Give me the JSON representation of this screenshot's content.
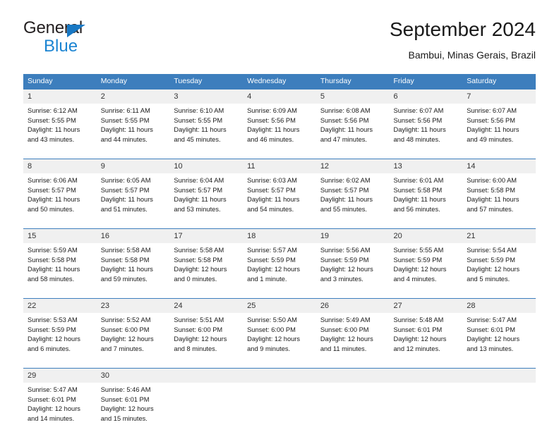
{
  "brand": {
    "word1": "General",
    "word2": "Blue",
    "triangle_color": "#1878c4",
    "blue_color": "#1b84d2"
  },
  "header": {
    "month_title": "September 2024",
    "location": "Bambui, Minas Gerais, Brazil"
  },
  "theme": {
    "header_blue": "#3d7ebd",
    "daynum_gray": "#f0f0f0",
    "text": "#1a1a1a"
  },
  "weekday_headers": [
    "Sunday",
    "Monday",
    "Tuesday",
    "Wednesday",
    "Thursday",
    "Friday",
    "Saturday"
  ],
  "weeks": [
    [
      {
        "day": "1",
        "sunrise": "Sunrise: 6:12 AM",
        "sunset": "Sunset: 5:55 PM",
        "daylight1": "Daylight: 11 hours",
        "daylight2": "and 43 minutes."
      },
      {
        "day": "2",
        "sunrise": "Sunrise: 6:11 AM",
        "sunset": "Sunset: 5:55 PM",
        "daylight1": "Daylight: 11 hours",
        "daylight2": "and 44 minutes."
      },
      {
        "day": "3",
        "sunrise": "Sunrise: 6:10 AM",
        "sunset": "Sunset: 5:55 PM",
        "daylight1": "Daylight: 11 hours",
        "daylight2": "and 45 minutes."
      },
      {
        "day": "4",
        "sunrise": "Sunrise: 6:09 AM",
        "sunset": "Sunset: 5:56 PM",
        "daylight1": "Daylight: 11 hours",
        "daylight2": "and 46 minutes."
      },
      {
        "day": "5",
        "sunrise": "Sunrise: 6:08 AM",
        "sunset": "Sunset: 5:56 PM",
        "daylight1": "Daylight: 11 hours",
        "daylight2": "and 47 minutes."
      },
      {
        "day": "6",
        "sunrise": "Sunrise: 6:07 AM",
        "sunset": "Sunset: 5:56 PM",
        "daylight1": "Daylight: 11 hours",
        "daylight2": "and 48 minutes."
      },
      {
        "day": "7",
        "sunrise": "Sunrise: 6:07 AM",
        "sunset": "Sunset: 5:56 PM",
        "daylight1": "Daylight: 11 hours",
        "daylight2": "and 49 minutes."
      }
    ],
    [
      {
        "day": "8",
        "sunrise": "Sunrise: 6:06 AM",
        "sunset": "Sunset: 5:57 PM",
        "daylight1": "Daylight: 11 hours",
        "daylight2": "and 50 minutes."
      },
      {
        "day": "9",
        "sunrise": "Sunrise: 6:05 AM",
        "sunset": "Sunset: 5:57 PM",
        "daylight1": "Daylight: 11 hours",
        "daylight2": "and 51 minutes."
      },
      {
        "day": "10",
        "sunrise": "Sunrise: 6:04 AM",
        "sunset": "Sunset: 5:57 PM",
        "daylight1": "Daylight: 11 hours",
        "daylight2": "and 53 minutes."
      },
      {
        "day": "11",
        "sunrise": "Sunrise: 6:03 AM",
        "sunset": "Sunset: 5:57 PM",
        "daylight1": "Daylight: 11 hours",
        "daylight2": "and 54 minutes."
      },
      {
        "day": "12",
        "sunrise": "Sunrise: 6:02 AM",
        "sunset": "Sunset: 5:57 PM",
        "daylight1": "Daylight: 11 hours",
        "daylight2": "and 55 minutes."
      },
      {
        "day": "13",
        "sunrise": "Sunrise: 6:01 AM",
        "sunset": "Sunset: 5:58 PM",
        "daylight1": "Daylight: 11 hours",
        "daylight2": "and 56 minutes."
      },
      {
        "day": "14",
        "sunrise": "Sunrise: 6:00 AM",
        "sunset": "Sunset: 5:58 PM",
        "daylight1": "Daylight: 11 hours",
        "daylight2": "and 57 minutes."
      }
    ],
    [
      {
        "day": "15",
        "sunrise": "Sunrise: 5:59 AM",
        "sunset": "Sunset: 5:58 PM",
        "daylight1": "Daylight: 11 hours",
        "daylight2": "and 58 minutes."
      },
      {
        "day": "16",
        "sunrise": "Sunrise: 5:58 AM",
        "sunset": "Sunset: 5:58 PM",
        "daylight1": "Daylight: 11 hours",
        "daylight2": "and 59 minutes."
      },
      {
        "day": "17",
        "sunrise": "Sunrise: 5:58 AM",
        "sunset": "Sunset: 5:58 PM",
        "daylight1": "Daylight: 12 hours",
        "daylight2": "and 0 minutes."
      },
      {
        "day": "18",
        "sunrise": "Sunrise: 5:57 AM",
        "sunset": "Sunset: 5:59 PM",
        "daylight1": "Daylight: 12 hours",
        "daylight2": "and 1 minute."
      },
      {
        "day": "19",
        "sunrise": "Sunrise: 5:56 AM",
        "sunset": "Sunset: 5:59 PM",
        "daylight1": "Daylight: 12 hours",
        "daylight2": "and 3 minutes."
      },
      {
        "day": "20",
        "sunrise": "Sunrise: 5:55 AM",
        "sunset": "Sunset: 5:59 PM",
        "daylight1": "Daylight: 12 hours",
        "daylight2": "and 4 minutes."
      },
      {
        "day": "21",
        "sunrise": "Sunrise: 5:54 AM",
        "sunset": "Sunset: 5:59 PM",
        "daylight1": "Daylight: 12 hours",
        "daylight2": "and 5 minutes."
      }
    ],
    [
      {
        "day": "22",
        "sunrise": "Sunrise: 5:53 AM",
        "sunset": "Sunset: 5:59 PM",
        "daylight1": "Daylight: 12 hours",
        "daylight2": "and 6 minutes."
      },
      {
        "day": "23",
        "sunrise": "Sunrise: 5:52 AM",
        "sunset": "Sunset: 6:00 PM",
        "daylight1": "Daylight: 12 hours",
        "daylight2": "and 7 minutes."
      },
      {
        "day": "24",
        "sunrise": "Sunrise: 5:51 AM",
        "sunset": "Sunset: 6:00 PM",
        "daylight1": "Daylight: 12 hours",
        "daylight2": "and 8 minutes."
      },
      {
        "day": "25",
        "sunrise": "Sunrise: 5:50 AM",
        "sunset": "Sunset: 6:00 PM",
        "daylight1": "Daylight: 12 hours",
        "daylight2": "and 9 minutes."
      },
      {
        "day": "26",
        "sunrise": "Sunrise: 5:49 AM",
        "sunset": "Sunset: 6:00 PM",
        "daylight1": "Daylight: 12 hours",
        "daylight2": "and 11 minutes."
      },
      {
        "day": "27",
        "sunrise": "Sunrise: 5:48 AM",
        "sunset": "Sunset: 6:01 PM",
        "daylight1": "Daylight: 12 hours",
        "daylight2": "and 12 minutes."
      },
      {
        "day": "28",
        "sunrise": "Sunrise: 5:47 AM",
        "sunset": "Sunset: 6:01 PM",
        "daylight1": "Daylight: 12 hours",
        "daylight2": "and 13 minutes."
      }
    ],
    [
      {
        "day": "29",
        "sunrise": "Sunrise: 5:47 AM",
        "sunset": "Sunset: 6:01 PM",
        "daylight1": "Daylight: 12 hours",
        "daylight2": "and 14 minutes."
      },
      {
        "day": "30",
        "sunrise": "Sunrise: 5:46 AM",
        "sunset": "Sunset: 6:01 PM",
        "daylight1": "Daylight: 12 hours",
        "daylight2": "and 15 minutes."
      },
      {
        "day": "",
        "sunrise": "",
        "sunset": "",
        "daylight1": "",
        "daylight2": ""
      },
      {
        "day": "",
        "sunrise": "",
        "sunset": "",
        "daylight1": "",
        "daylight2": ""
      },
      {
        "day": "",
        "sunrise": "",
        "sunset": "",
        "daylight1": "",
        "daylight2": ""
      },
      {
        "day": "",
        "sunrise": "",
        "sunset": "",
        "daylight1": "",
        "daylight2": ""
      },
      {
        "day": "",
        "sunrise": "",
        "sunset": "",
        "daylight1": "",
        "daylight2": ""
      }
    ]
  ]
}
